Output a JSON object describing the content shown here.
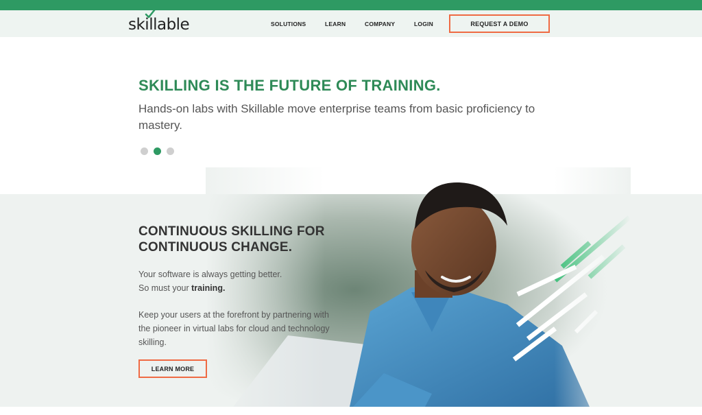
{
  "brand": {
    "logo_text": "skillable",
    "accent": "#2e9a63",
    "cta_border": "#ef6a43"
  },
  "nav": {
    "items": [
      "SOLUTIONS",
      "LEARN",
      "COMPANY",
      "LOGIN"
    ],
    "cta": "REQUEST A DEMO"
  },
  "hero": {
    "title": "SKILLING IS THE FUTURE OF TRAINING.",
    "subtitle": "Hands-on labs with Skillable move enterprise teams from basic proficiency to mastery.",
    "carousel": {
      "slides": 3,
      "active": 2
    }
  },
  "section": {
    "title_line1": "CONTINUOUS SKILLING FOR",
    "title_line2": "CONTINUOUS CHANGE.",
    "line1": "Your software is always getting better.",
    "line2_prefix": "So must your ",
    "line2_bold": "training.",
    "paragraph": "Keep your users at the forefront by partnering with the pioneer in virtual labs for cloud and technology skilling.",
    "cta": "LEARN MORE"
  },
  "icons": {
    "logo_check": "checkmark-icon",
    "decor_stripes": "diagonal-stripes-decoration"
  }
}
